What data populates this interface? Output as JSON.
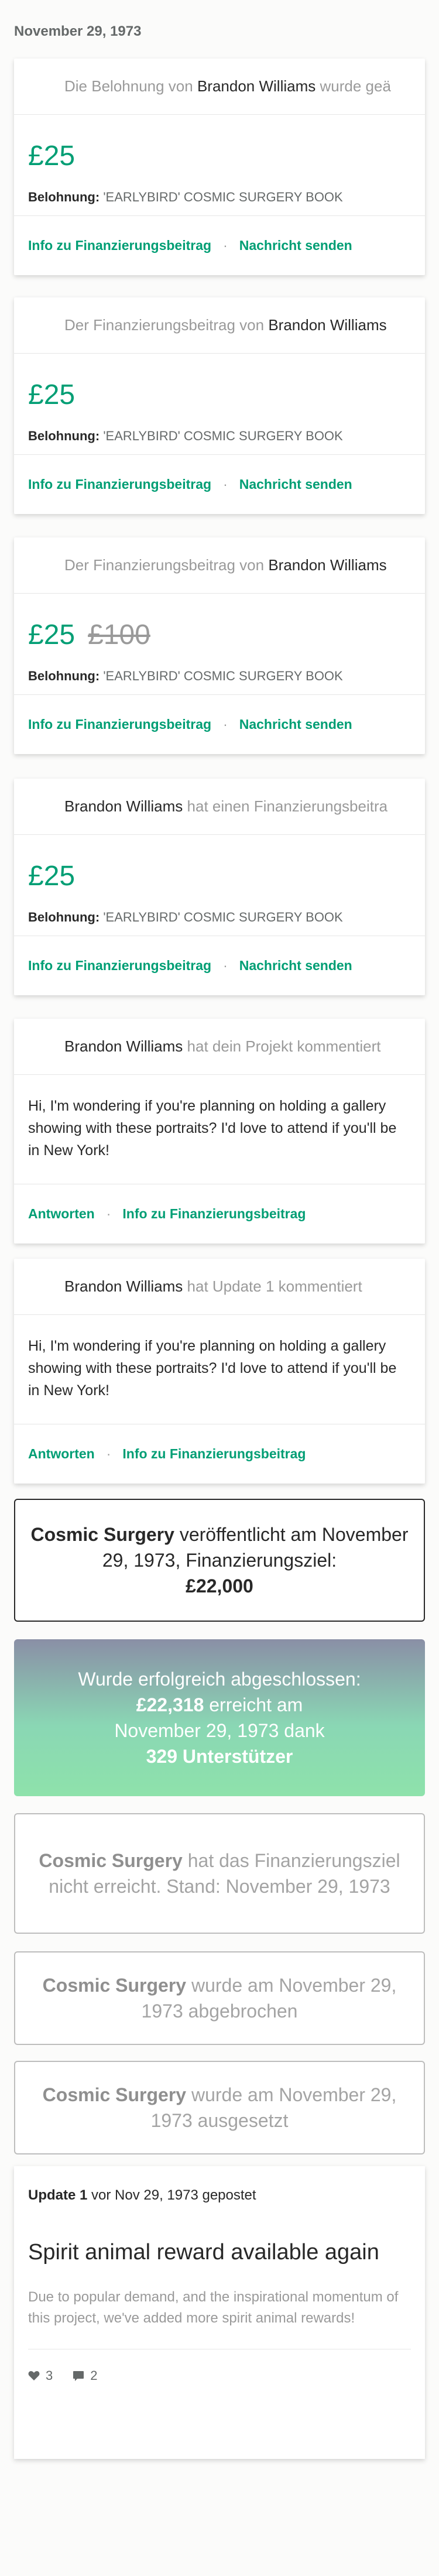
{
  "date_header": "November 29, 1973",
  "backer_name": "Brandon Williams",
  "project_name": "Cosmic Surgery",
  "colors": {
    "accent": "#009e74",
    "muted": "#9a9a9a",
    "text": "#282828"
  },
  "reward_label": "Belohnung:",
  "reward_value": "'EARLYBIRD' COSMIC SURGERY BOOK",
  "link_info": "Info zu Finanzierungsbeitrag",
  "link_message": "Nachricht senden",
  "link_reply": "Antworten",
  "separator": "·",
  "cards": [
    {
      "head_prefix": "Die Belohnung von",
      "head_suffix": "wurde geä",
      "amount": "£25"
    },
    {
      "head_prefix": "Der Finanzierungsbeitrag von",
      "head_suffix": "",
      "amount": "£25"
    },
    {
      "head_prefix": "Der Finanzierungsbeitrag von",
      "head_suffix": "",
      "amount": "£25",
      "old_amount": "£100"
    },
    {
      "head_prefix": "",
      "head_suffix": "hat einen Finanzierungsbeitra",
      "amount": "£25"
    }
  ],
  "comments": [
    {
      "head_suffix": "hat dein Projekt kommentiert",
      "text": "Hi, I'm wondering if you're planning on holding a gallery showing with these portraits? I'd love to attend if you'll be in New York!"
    },
    {
      "head_suffix": "hat Update 1 kommentiert",
      "text": "Hi, I'm wondering if you're planning on holding a gallery showing with these portraits? I'd love to attend if you'll be in New York!"
    }
  ],
  "launch": {
    "text1": "veröffentlicht am",
    "date": "November 29, 1973",
    "text2": ", Finanzierungsziel:",
    "goal": "£22,000"
  },
  "success": {
    "line1": "Wurde erfolgreich abgeschlossen:",
    "amount": "£22,318",
    "line2": "erreicht am",
    "line3": "November 29, 1973 dank",
    "backers": "329 Unterstützer"
  },
  "failed": {
    "text": "hat das Finanzierungsziel nicht erreicht. Stand: November 29, 1973"
  },
  "canceled": {
    "text": "wurde am November 29, 1973 abgebrochen"
  },
  "suspended": {
    "text": "wurde am November 29, 1973 ausgesetzt"
  },
  "update": {
    "label": "Update 1",
    "meta": "vor Nov 29, 1973 gepostet",
    "title": "Spirit animal reward available again",
    "description": "Due to popular demand, and the inspirational momentum of this project, we've added more spirit animal rewards!",
    "likes": "3",
    "comments": "2"
  }
}
